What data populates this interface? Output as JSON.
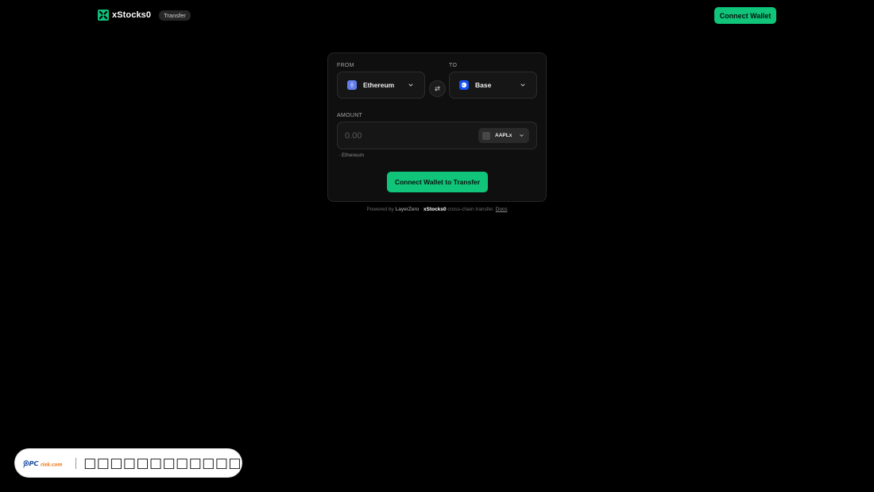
{
  "header": {
    "brand_name": "xStocks0",
    "tag": "Transfer",
    "connect_label": "Connect Wallet"
  },
  "colors": {
    "accent": "#10c57a",
    "background": "#000000",
    "ethereum": "#627eea",
    "base": "#1652f0"
  },
  "transfer": {
    "from_label": "FROM",
    "to_label": "TO",
    "from_chain": {
      "name": "Ethereum",
      "icon": "ethereum-icon",
      "glyph": "⟠"
    },
    "to_chain": {
      "name": "Base",
      "icon": "base-icon"
    },
    "swap_icon": "swap-arrows-icon",
    "amount_label": "AMOUNT",
    "amount_placeholder": "0.00",
    "token": {
      "name": "AAPLx",
      "icon": "apple-icon",
      "glyph": ""
    },
    "chain_hint": "· Ethereum",
    "submit_label": "Connect Wallet to Transfer"
  },
  "footer": {
    "powered_prefix": "Powered by",
    "provider": "LayerZero",
    "separator": "·",
    "brand": "xStocks0",
    "description": "cross-chain transfer.",
    "docs_label": "Docs"
  },
  "watermark": {
    "logo_text": "PCrisk.com",
    "caption": "□□□□□□□□□□□□"
  }
}
